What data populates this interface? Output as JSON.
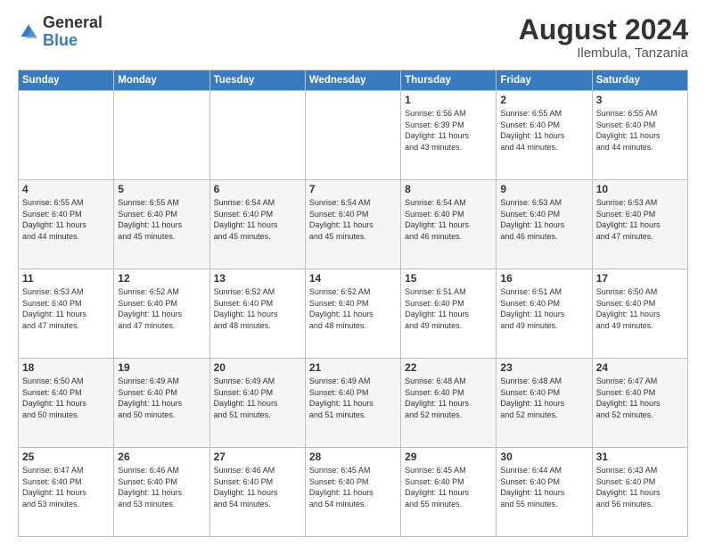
{
  "logo": {
    "general": "General",
    "blue": "Blue"
  },
  "title": "August 2024",
  "location": "Ilembula, Tanzania",
  "weekdays": [
    "Sunday",
    "Monday",
    "Tuesday",
    "Wednesday",
    "Thursday",
    "Friday",
    "Saturday"
  ],
  "weeks": [
    [
      {
        "day": "",
        "info": ""
      },
      {
        "day": "",
        "info": ""
      },
      {
        "day": "",
        "info": ""
      },
      {
        "day": "",
        "info": ""
      },
      {
        "day": "1",
        "info": "Sunrise: 6:56 AM\nSunset: 6:39 PM\nDaylight: 11 hours\nand 43 minutes."
      },
      {
        "day": "2",
        "info": "Sunrise: 6:55 AM\nSunset: 6:40 PM\nDaylight: 11 hours\nand 44 minutes."
      },
      {
        "day": "3",
        "info": "Sunrise: 6:55 AM\nSunset: 6:40 PM\nDaylight: 11 hours\nand 44 minutes."
      }
    ],
    [
      {
        "day": "4",
        "info": "Sunrise: 6:55 AM\nSunset: 6:40 PM\nDaylight: 11 hours\nand 44 minutes."
      },
      {
        "day": "5",
        "info": "Sunrise: 6:55 AM\nSunset: 6:40 PM\nDaylight: 11 hours\nand 45 minutes."
      },
      {
        "day": "6",
        "info": "Sunrise: 6:54 AM\nSunset: 6:40 PM\nDaylight: 11 hours\nand 45 minutes."
      },
      {
        "day": "7",
        "info": "Sunrise: 6:54 AM\nSunset: 6:40 PM\nDaylight: 11 hours\nand 45 minutes."
      },
      {
        "day": "8",
        "info": "Sunrise: 6:54 AM\nSunset: 6:40 PM\nDaylight: 11 hours\nand 46 minutes."
      },
      {
        "day": "9",
        "info": "Sunrise: 6:53 AM\nSunset: 6:40 PM\nDaylight: 11 hours\nand 46 minutes."
      },
      {
        "day": "10",
        "info": "Sunrise: 6:53 AM\nSunset: 6:40 PM\nDaylight: 11 hours\nand 47 minutes."
      }
    ],
    [
      {
        "day": "11",
        "info": "Sunrise: 6:53 AM\nSunset: 6:40 PM\nDaylight: 11 hours\nand 47 minutes."
      },
      {
        "day": "12",
        "info": "Sunrise: 6:52 AM\nSunset: 6:40 PM\nDaylight: 11 hours\nand 47 minutes."
      },
      {
        "day": "13",
        "info": "Sunrise: 6:52 AM\nSunset: 6:40 PM\nDaylight: 11 hours\nand 48 minutes."
      },
      {
        "day": "14",
        "info": "Sunrise: 6:52 AM\nSunset: 6:40 PM\nDaylight: 11 hours\nand 48 minutes."
      },
      {
        "day": "15",
        "info": "Sunrise: 6:51 AM\nSunset: 6:40 PM\nDaylight: 11 hours\nand 49 minutes."
      },
      {
        "day": "16",
        "info": "Sunrise: 6:51 AM\nSunset: 6:40 PM\nDaylight: 11 hours\nand 49 minutes."
      },
      {
        "day": "17",
        "info": "Sunrise: 6:50 AM\nSunset: 6:40 PM\nDaylight: 11 hours\nand 49 minutes."
      }
    ],
    [
      {
        "day": "18",
        "info": "Sunrise: 6:50 AM\nSunset: 6:40 PM\nDaylight: 11 hours\nand 50 minutes."
      },
      {
        "day": "19",
        "info": "Sunrise: 6:49 AM\nSunset: 6:40 PM\nDaylight: 11 hours\nand 50 minutes."
      },
      {
        "day": "20",
        "info": "Sunrise: 6:49 AM\nSunset: 6:40 PM\nDaylight: 11 hours\nand 51 minutes."
      },
      {
        "day": "21",
        "info": "Sunrise: 6:49 AM\nSunset: 6:40 PM\nDaylight: 11 hours\nand 51 minutes."
      },
      {
        "day": "22",
        "info": "Sunrise: 6:48 AM\nSunset: 6:40 PM\nDaylight: 11 hours\nand 52 minutes."
      },
      {
        "day": "23",
        "info": "Sunrise: 6:48 AM\nSunset: 6:40 PM\nDaylight: 11 hours\nand 52 minutes."
      },
      {
        "day": "24",
        "info": "Sunrise: 6:47 AM\nSunset: 6:40 PM\nDaylight: 11 hours\nand 52 minutes."
      }
    ],
    [
      {
        "day": "25",
        "info": "Sunrise: 6:47 AM\nSunset: 6:40 PM\nDaylight: 11 hours\nand 53 minutes."
      },
      {
        "day": "26",
        "info": "Sunrise: 6:46 AM\nSunset: 6:40 PM\nDaylight: 11 hours\nand 53 minutes."
      },
      {
        "day": "27",
        "info": "Sunrise: 6:46 AM\nSunset: 6:40 PM\nDaylight: 11 hours\nand 54 minutes."
      },
      {
        "day": "28",
        "info": "Sunrise: 6:45 AM\nSunset: 6:40 PM\nDaylight: 11 hours\nand 54 minutes."
      },
      {
        "day": "29",
        "info": "Sunrise: 6:45 AM\nSunset: 6:40 PM\nDaylight: 11 hours\nand 55 minutes."
      },
      {
        "day": "30",
        "info": "Sunrise: 6:44 AM\nSunset: 6:40 PM\nDaylight: 11 hours\nand 55 minutes."
      },
      {
        "day": "31",
        "info": "Sunrise: 6:43 AM\nSunset: 6:40 PM\nDaylight: 11 hours\nand 56 minutes."
      }
    ]
  ]
}
